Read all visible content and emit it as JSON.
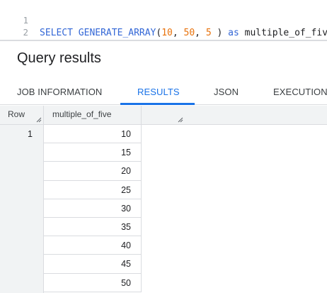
{
  "editor": {
    "line_numbers": [
      "1",
      "2"
    ],
    "tokens": {
      "select": "SELECT",
      "function": "GENERATE_ARRAY",
      "open_paren": "(",
      "arg1": "10",
      "comma1": ", ",
      "arg2": "50",
      "comma2": ", ",
      "arg3": "5",
      "close_paren": " )",
      "as": " as ",
      "alias": "multiple_of_five"
    }
  },
  "results": {
    "title": "Query results",
    "tabs": [
      "JOB INFORMATION",
      "RESULTS",
      "JSON",
      "EXECUTION"
    ],
    "active_tab": "RESULTS"
  },
  "table": {
    "columns": [
      "Row",
      "multiple_of_five"
    ],
    "rows": [
      {
        "row": "1",
        "value": "10"
      },
      {
        "row": "",
        "value": "15"
      },
      {
        "row": "",
        "value": "20"
      },
      {
        "row": "",
        "value": "25"
      },
      {
        "row": "",
        "value": "30"
      },
      {
        "row": "",
        "value": "35"
      },
      {
        "row": "",
        "value": "40"
      },
      {
        "row": "",
        "value": "45"
      },
      {
        "row": "",
        "value": "50"
      }
    ]
  },
  "colors": {
    "keyword": "#3367d6",
    "number": "#e8710a",
    "active_tab": "#1a73e8",
    "grid_header_bg": "#f1f3f4"
  }
}
